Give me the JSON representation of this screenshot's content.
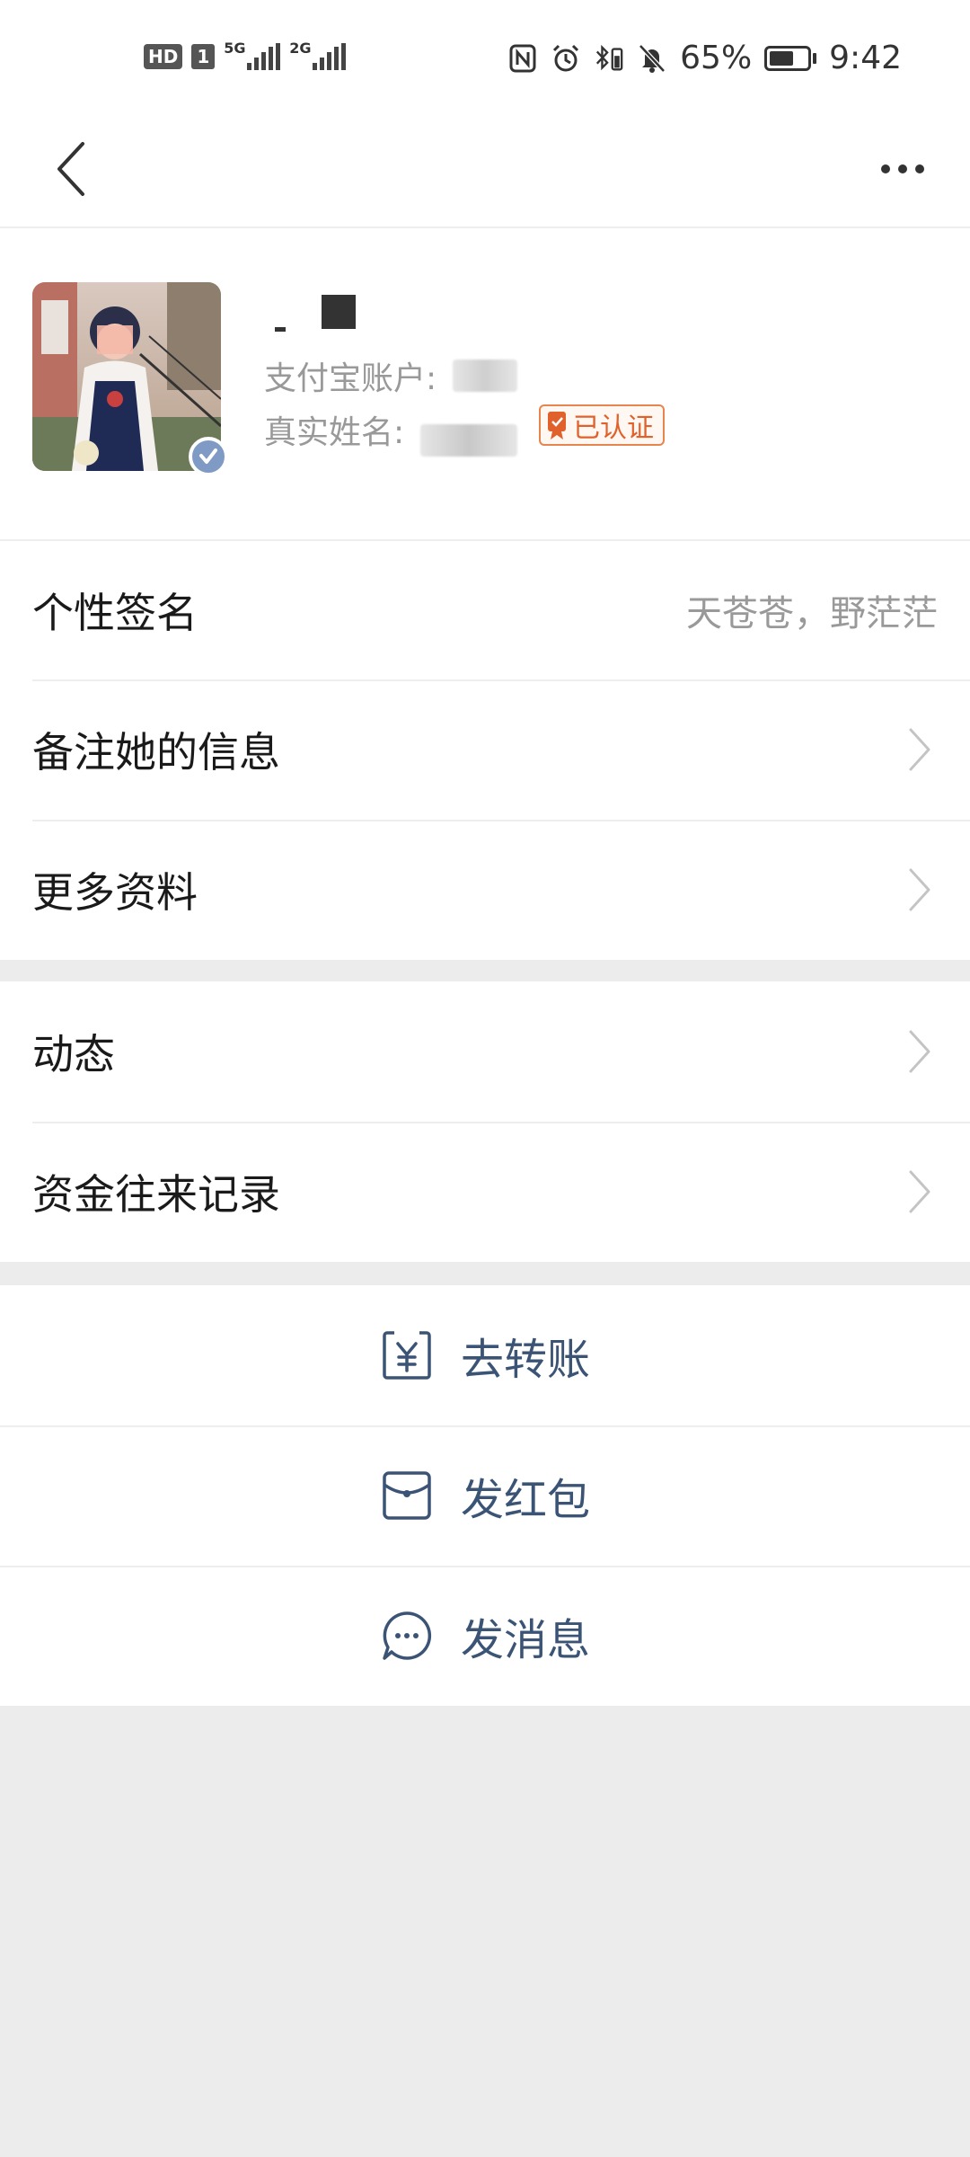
{
  "status_bar": {
    "hd": "HD",
    "sim": "1",
    "net1": "5G",
    "net2": "2G",
    "battery_percent": "65%",
    "battery_level": 0.65,
    "time": "9:42"
  },
  "profile": {
    "account_label": "支付宝账户:",
    "realname_label": "真实姓名:",
    "verified_label": "已认证"
  },
  "info_rows": [
    {
      "label": "个性签名",
      "value": "天苍苍，野茫茫"
    },
    {
      "label": "备注她的信息"
    },
    {
      "label": "更多资料"
    }
  ],
  "feed_rows": [
    {
      "label": "动态"
    },
    {
      "label": "资金往来记录"
    }
  ],
  "actions": [
    {
      "label": "去转账",
      "icon": "transfer-icon"
    },
    {
      "label": "发红包",
      "icon": "red-packet-icon"
    },
    {
      "label": "发消息",
      "icon": "message-icon"
    }
  ],
  "colors": {
    "action_blue": "#3b5475",
    "verified_orange": "#e0612b",
    "background_gray": "#ececec"
  }
}
